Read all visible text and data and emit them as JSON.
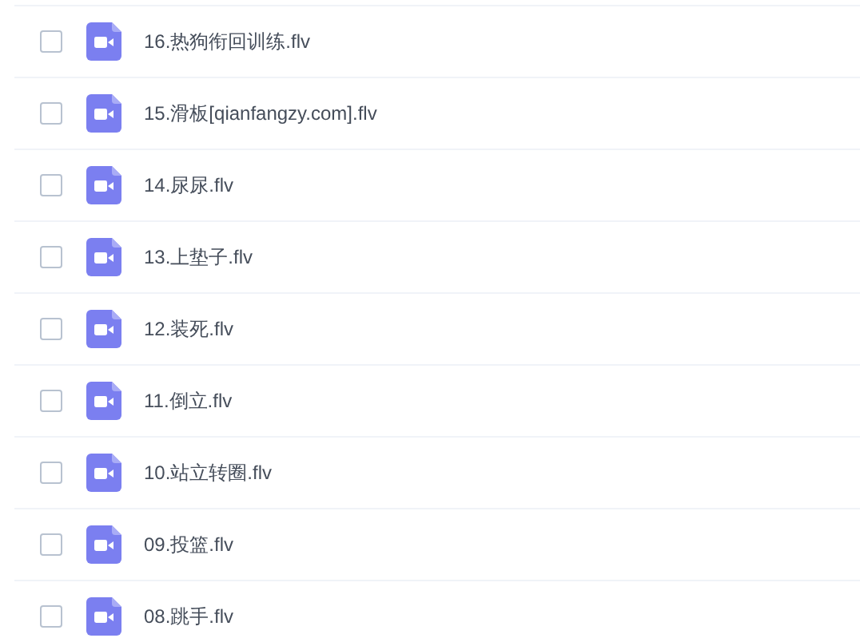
{
  "files": [
    {
      "name": "16.热狗衔回训练.flv",
      "checked": false
    },
    {
      "name": "15.滑板[qianfangzy.com].flv",
      "checked": false
    },
    {
      "name": "14.尿尿.flv",
      "checked": false
    },
    {
      "name": "13.上垫子.flv",
      "checked": false
    },
    {
      "name": "12.装死.flv",
      "checked": false
    },
    {
      "name": "11.倒立.flv",
      "checked": false
    },
    {
      "name": "10.站立转圈.flv",
      "checked": false
    },
    {
      "name": "09.投篮.flv",
      "checked": false
    },
    {
      "name": "08.跳手.flv",
      "checked": false
    }
  ]
}
